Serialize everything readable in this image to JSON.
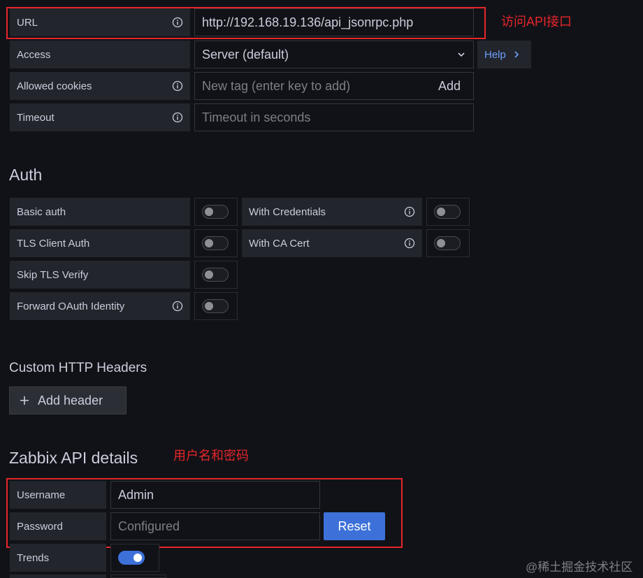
{
  "http": {
    "url_label": "URL",
    "url_value": "http://192.168.19.136/api_jsonrpc.php",
    "access_label": "Access",
    "access_value": "Server (default)",
    "help_label": "Help",
    "cookies_label": "Allowed cookies",
    "cookies_placeholder": "New tag (enter key to add)",
    "cookies_add": "Add",
    "timeout_label": "Timeout",
    "timeout_placeholder": "Timeout in seconds"
  },
  "auth": {
    "title": "Auth",
    "basic_auth": {
      "label": "Basic auth",
      "on": false
    },
    "with_credentials": {
      "label": "With Credentials",
      "on": false
    },
    "tls_client_auth": {
      "label": "TLS Client Auth",
      "on": false
    },
    "with_ca_cert": {
      "label": "With CA Cert",
      "on": false
    },
    "skip_tls_verify": {
      "label": "Skip TLS Verify",
      "on": false
    },
    "forward_oauth": {
      "label": "Forward OAuth Identity",
      "on": false
    }
  },
  "headers": {
    "title": "Custom HTTP Headers",
    "add_button": "Add header"
  },
  "zabbix": {
    "title": "Zabbix API details",
    "username_label": "Username",
    "username_value": "Admin",
    "password_label": "Password",
    "password_placeholder": "Configured",
    "reset_button": "Reset",
    "trends_label": "Trends",
    "trends_on": true
  },
  "annotations": {
    "url_note": "访问API接口",
    "credentials_note": "用户名和密码"
  },
  "watermark": "@稀土掘金技术社区",
  "colors": {
    "accent": "#3d71d9",
    "annotation_red": "#e5262b",
    "link_blue": "#6e9fff"
  }
}
